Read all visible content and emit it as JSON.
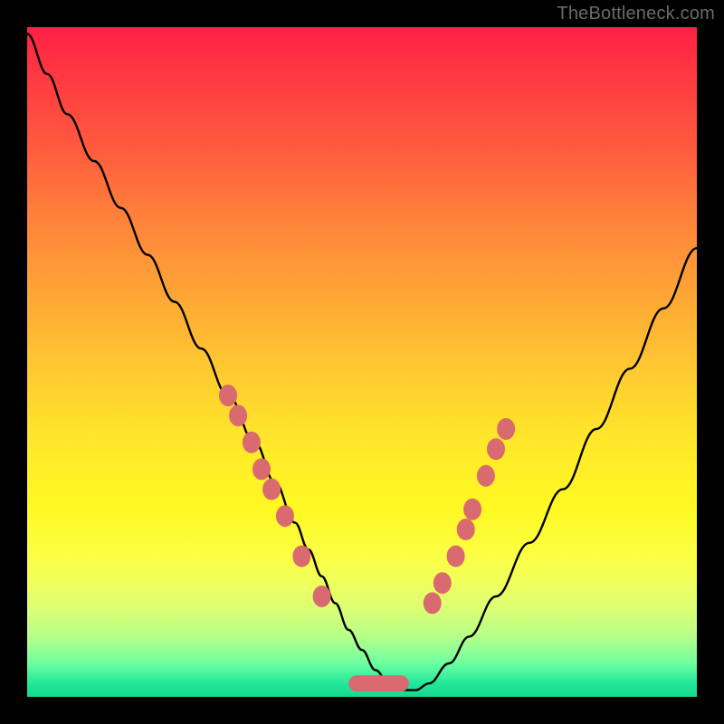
{
  "watermark": "TheBottleneck.com",
  "colors": {
    "frame": "#000000",
    "curve": "#000000",
    "marker_fill": "#d96a6f",
    "gradient_top": "#ff1f46",
    "gradient_bottom": "#14d98f"
  },
  "chart_data": {
    "type": "line",
    "title": "",
    "xlabel": "",
    "ylabel": "",
    "xlim": [
      0,
      100
    ],
    "ylim": [
      0,
      100
    ],
    "series": [
      {
        "name": "curve",
        "x": [
          0,
          3,
          6,
          10,
          14,
          18,
          22,
          26,
          30,
          34,
          37,
          40,
          42,
          44,
          46,
          48,
          50,
          52,
          54,
          56,
          58,
          60,
          63,
          66,
          70,
          75,
          80,
          85,
          90,
          95,
          100
        ],
        "y": [
          99,
          93,
          87,
          80,
          73,
          66,
          59,
          52,
          45,
          38,
          32,
          26,
          22,
          18,
          14,
          10,
          7,
          4,
          2,
          1,
          1,
          2,
          5,
          9,
          15,
          23,
          31,
          40,
          49,
          58,
          67
        ]
      }
    ],
    "markers": [
      {
        "x": 30,
        "y": 45
      },
      {
        "x": 31.5,
        "y": 42
      },
      {
        "x": 33.5,
        "y": 38
      },
      {
        "x": 35,
        "y": 34
      },
      {
        "x": 36.5,
        "y": 31
      },
      {
        "x": 38.5,
        "y": 27
      },
      {
        "x": 41,
        "y": 21
      },
      {
        "x": 44,
        "y": 15
      },
      {
        "x": 60.5,
        "y": 14
      },
      {
        "x": 62,
        "y": 17
      },
      {
        "x": 64,
        "y": 21
      },
      {
        "x": 65.5,
        "y": 25
      },
      {
        "x": 66.5,
        "y": 28
      },
      {
        "x": 68.5,
        "y": 33
      },
      {
        "x": 70,
        "y": 37
      },
      {
        "x": 71.5,
        "y": 40
      }
    ],
    "flat_segment": {
      "x0": 48,
      "x1": 57,
      "y": 2
    }
  }
}
